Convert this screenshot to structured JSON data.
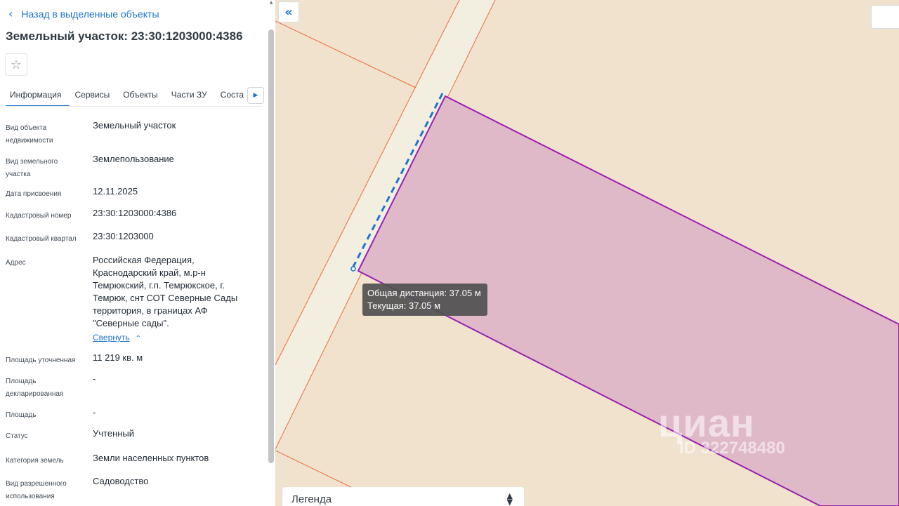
{
  "sidebar": {
    "back_label": "Назад в выделенные объекты",
    "title": "Земельный участок: 23:30:1203000:4386",
    "tabs": [
      {
        "label": "Информация"
      },
      {
        "label": "Сервисы"
      },
      {
        "label": "Объекты"
      },
      {
        "label": "Части ЗУ"
      },
      {
        "label": "Соста"
      }
    ],
    "rows": [
      {
        "label": "Вид объекта недвижимости",
        "value": "Земельный участок"
      },
      {
        "label": "Вид земельного участка",
        "value": "Землепользование"
      },
      {
        "label": "Дата присвоения",
        "value": "12.11.2025"
      },
      {
        "label": "Кадастровый номер",
        "value": "23:30:1203000:4386"
      },
      {
        "label": "Кадастровый квартал",
        "value": "23:30:1203000"
      },
      {
        "label": "Адрес",
        "value": "Российская Федерация, Краснодарский край, м.р-н Темрюкский, г.п. Темрюкское, г. Темрюк, снт СОТ Северные Сады территория, в границах АФ \"Северные сады\"."
      },
      {
        "label": "Площадь уточненная",
        "value": "11 219 кв. м"
      },
      {
        "label": "Площадь декларированная",
        "value": "-"
      },
      {
        "label": "Площадь",
        "value": "-"
      },
      {
        "label": "Статус",
        "value": "Учтенный"
      },
      {
        "label": "Категория земель",
        "value": "Земли населенных пунктов"
      },
      {
        "label": "Вид разрешенного использования",
        "value": "Садоводство"
      }
    ],
    "collapse_label": "Свернуть"
  },
  "map": {
    "tooltip": {
      "total": "Общая дистанция: 37.05 м",
      "current": "Текущая: 37.05 м"
    },
    "legend_label": "Легенда",
    "watermark": {
      "logo": "циан",
      "id": "ID 322748480"
    },
    "colors": {
      "background": "#f1e2cd",
      "road": "#f2efe0",
      "parcel_fill": "#e0b9c9",
      "parcel_stroke": "#9a1fb0",
      "boundary": "#ee6a3c",
      "measure": "#1e74d2"
    }
  }
}
